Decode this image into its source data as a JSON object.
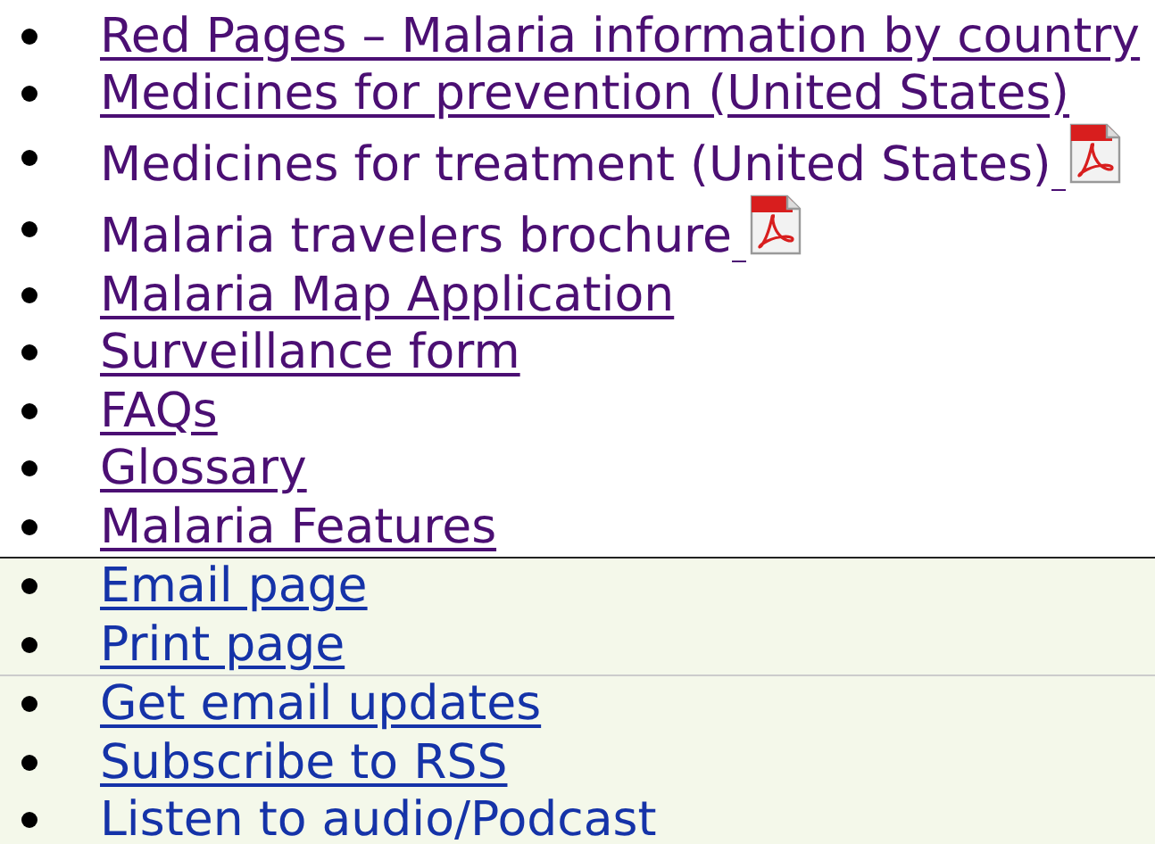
{
  "sections": [
    {
      "shaded": false,
      "items": [
        {
          "text": "Red Pages – Malaria information by country",
          "visited": true,
          "underlined": true,
          "pdf": false
        },
        {
          "text": "Medicines for prevention (United States)",
          "visited": true,
          "underlined": true,
          "pdf": false
        },
        {
          "text": "Medicines for treatment (United States)",
          "visited": true,
          "underlined": false,
          "pdf": true
        },
        {
          "text": "Malaria travelers brochure",
          "visited": true,
          "underlined": false,
          "pdf": true
        },
        {
          "text": "Malaria Map Application",
          "visited": true,
          "underlined": true,
          "pdf": false
        },
        {
          "text": "Surveillance form",
          "visited": true,
          "underlined": true,
          "pdf": false
        },
        {
          "text": "FAQs",
          "visited": true,
          "underlined": true,
          "pdf": false
        },
        {
          "text": "Glossary",
          "visited": true,
          "underlined": true,
          "pdf": false
        },
        {
          "text": "Malaria Features",
          "visited": true,
          "underlined": true,
          "pdf": false
        }
      ]
    },
    {
      "shaded": true,
      "items": [
        {
          "text": "Email page",
          "visited": false,
          "underlined": true,
          "pdf": false
        },
        {
          "text": "Print page",
          "visited": false,
          "underlined": true,
          "pdf": false
        }
      ]
    },
    {
      "shaded": true,
      "items": [
        {
          "text": "Get email updates",
          "visited": false,
          "underlined": true,
          "pdf": false
        },
        {
          "text": "Subscribe to RSS",
          "visited": false,
          "underlined": true,
          "pdf": false
        },
        {
          "text": "Listen to audio/Podcast",
          "visited": false,
          "underlined": false,
          "pdf": false
        }
      ]
    }
  ]
}
